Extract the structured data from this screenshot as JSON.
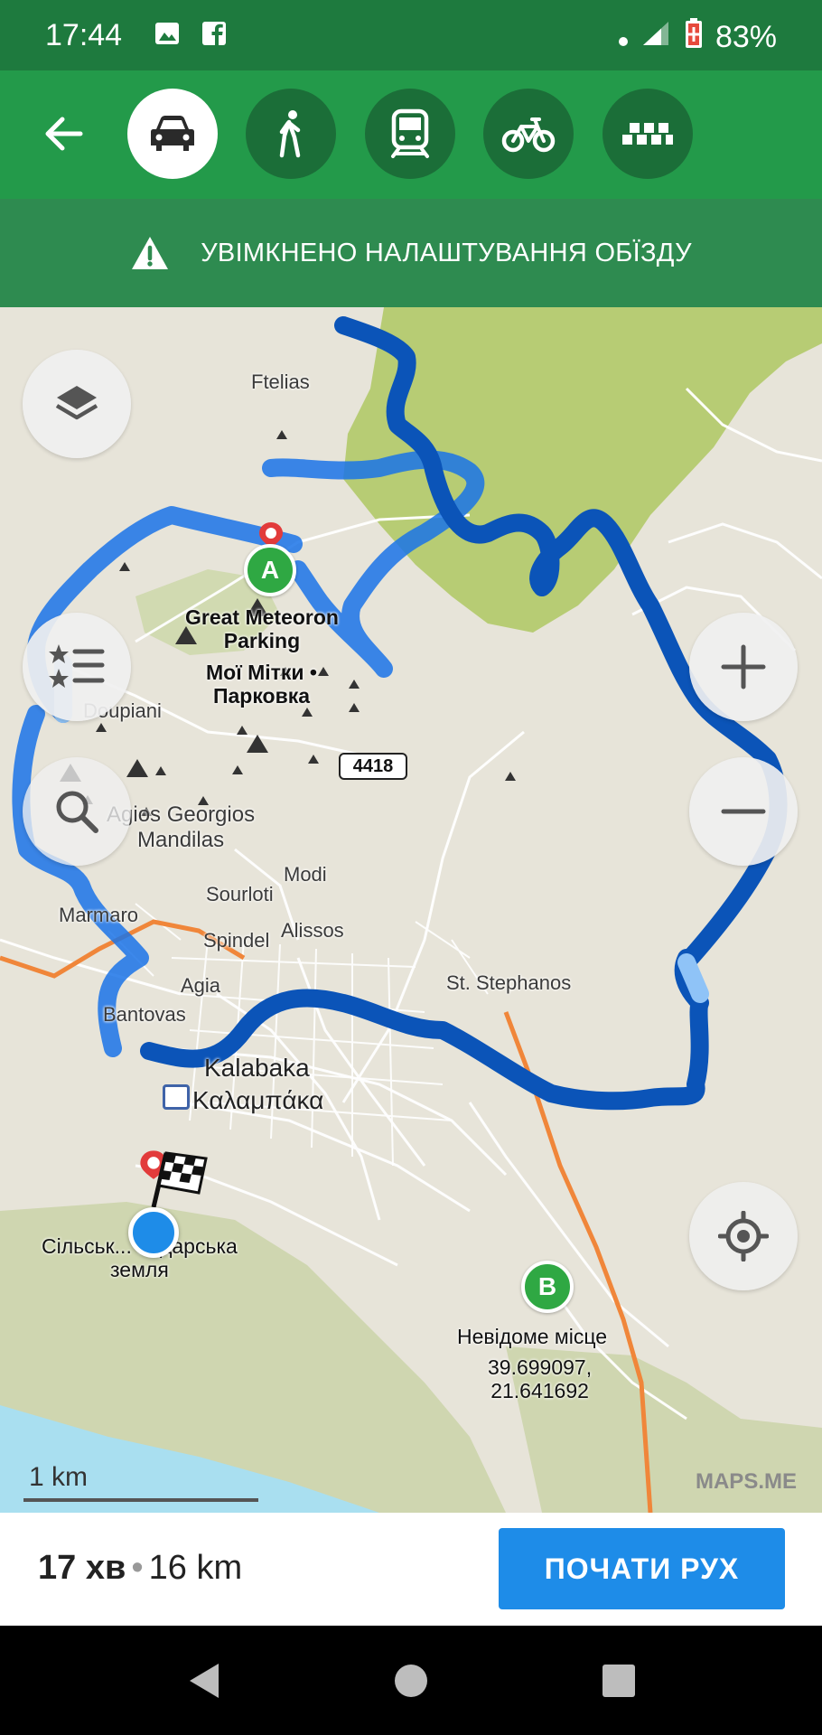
{
  "status_bar": {
    "time": "17:44",
    "battery": "83%",
    "icons": [
      "image-icon",
      "facebook-icon",
      "notification-dot-icon",
      "signal-icon",
      "battery-icon"
    ]
  },
  "transport": {
    "back_icon": "arrow-left-icon",
    "modes": [
      {
        "name": "car",
        "icon": "car-icon",
        "active": true
      },
      {
        "name": "walk",
        "icon": "pedestrian-icon",
        "active": false
      },
      {
        "name": "transit",
        "icon": "train-icon",
        "active": false
      },
      {
        "name": "bike",
        "icon": "bicycle-icon",
        "active": false
      },
      {
        "name": "taxi",
        "icon": "taxi-icon",
        "active": false
      }
    ]
  },
  "banner": {
    "text": "УВІМКНЕНО НАЛАШТУВАННЯ ОБЇЗДУ",
    "icon": "warning-icon"
  },
  "map": {
    "labels": {
      "ftelias": "Ftelias",
      "meteoron": "Great Meteoron\nParking",
      "my_marks": "Мої Мітки •\nПарковка",
      "doupiani": "Doupiani",
      "agios": "Agios Georgios\nMandilas",
      "modi": "Modi",
      "sourloti": "Sourloti",
      "marmaro": "Marmaro",
      "spindel": "Spindel",
      "alissos": "Alissos",
      "agia": "Agia",
      "bantovas": "Bantovas",
      "stephanos": "St. Stephanos",
      "kalabaka": "Kalabaka",
      "kalampaka_gr": "Καλαμπάκα",
      "farmland": "Сільськ... подарська\nземля",
      "unknown_place": "Невідоме місце",
      "coords": "39.699097,\n21.641692"
    },
    "road_shield": "4418",
    "marker_a": "A",
    "marker_b": "B",
    "scale": "1 km",
    "watermark": "MAPS.ME",
    "colors": {
      "route": "#1a73e8",
      "route_dark": "#0b54b8",
      "forest": "#b3c96e",
      "land": "#e7e4d9",
      "water": "#a9dff0",
      "accent_green": "#239a4a"
    }
  },
  "bottom": {
    "time": "17 хв",
    "separator": "•",
    "distance": "16 km",
    "start_label": "ПОЧАТИ РУХ"
  }
}
